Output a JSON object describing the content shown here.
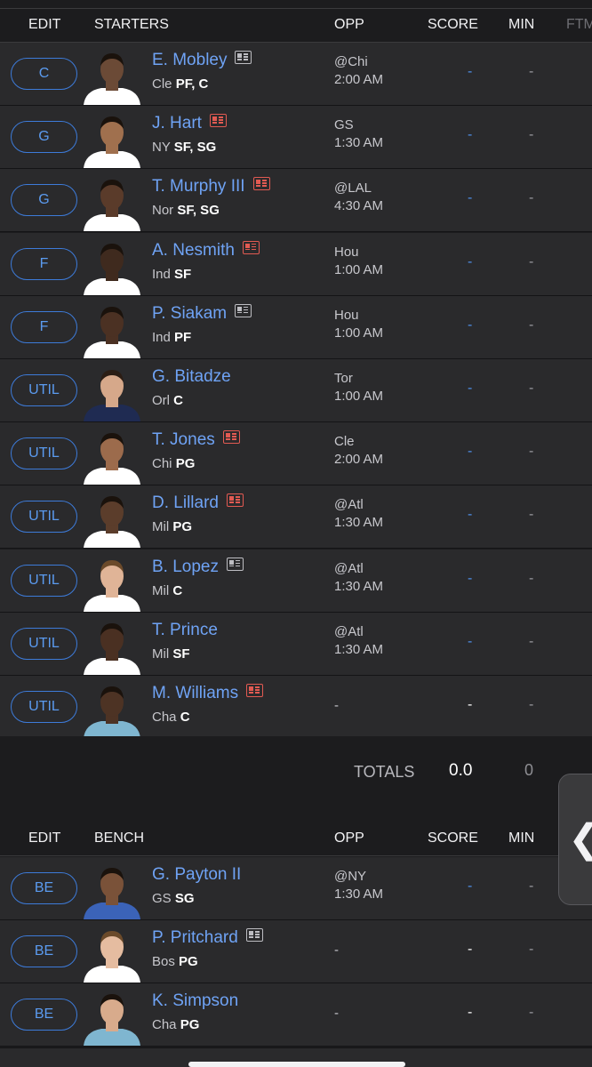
{
  "starters_header": {
    "edit": "EDIT",
    "title": "STARTERS",
    "opp": "OPP",
    "score": "SCORE",
    "min": "MIN",
    "ftm": "FTM"
  },
  "starters": [
    {
      "slot": "C",
      "name": "E. Mobley",
      "team": "Cle",
      "pos": "PF, C",
      "opp": "@Chi",
      "time": "2:00 AM",
      "score": "-",
      "min": "-",
      "news": "normal"
    },
    {
      "slot": "G",
      "name": "J. Hart",
      "team": "NY",
      "pos": "SF, SG",
      "opp": "GS",
      "time": "1:30 AM",
      "score": "-",
      "min": "-",
      "news": "alert"
    },
    {
      "slot": "G",
      "name": "T. Murphy III",
      "team": "Nor",
      "pos": "SF, SG",
      "opp": "@LAL",
      "time": "4:30 AM",
      "score": "-",
      "min": "-",
      "news": "alert"
    },
    {
      "slot": "F",
      "name": "A. Nesmith",
      "team": "Ind",
      "pos": "SF",
      "opp": "Hou",
      "time": "1:00 AM",
      "score": "-",
      "min": "-",
      "news": "alert"
    },
    {
      "slot": "F",
      "name": "P. Siakam",
      "team": "Ind",
      "pos": "PF",
      "opp": "Hou",
      "time": "1:00 AM",
      "score": "-",
      "min": "-",
      "news": "normal"
    },
    {
      "slot": "UTIL",
      "name": "G. Bitadze",
      "team": "Orl",
      "pos": "C",
      "opp": "Tor",
      "time": "1:00 AM",
      "score": "-",
      "min": "-",
      "news": ""
    },
    {
      "slot": "UTIL",
      "name": "T. Jones",
      "team": "Chi",
      "pos": "PG",
      "opp": "Cle",
      "time": "2:00 AM",
      "score": "-",
      "min": "-",
      "news": "alert"
    },
    {
      "slot": "UTIL",
      "name": "D. Lillard",
      "team": "Mil",
      "pos": "PG",
      "opp": "@Atl",
      "time": "1:30 AM",
      "score": "-",
      "min": "-",
      "news": "alert"
    },
    {
      "slot": "UTIL",
      "name": "B. Lopez",
      "team": "Mil",
      "pos": "C",
      "opp": "@Atl",
      "time": "1:30 AM",
      "score": "-",
      "min": "-",
      "news": "normal"
    },
    {
      "slot": "UTIL",
      "name": "T. Prince",
      "team": "Mil",
      "pos": "SF",
      "opp": "@Atl",
      "time": "1:30 AM",
      "score": "-",
      "min": "-",
      "news": ""
    },
    {
      "slot": "UTIL",
      "name": "M. Williams",
      "team": "Cha",
      "pos": "C",
      "opp": "-",
      "time": "",
      "score": "-",
      "min": "-",
      "news": "alert"
    }
  ],
  "totals": {
    "label": "TOTALS",
    "score": "0.0",
    "min": "0"
  },
  "bench_header": {
    "edit": "EDIT",
    "title": "BENCH",
    "opp": "OPP",
    "score": "SCORE",
    "min": "MIN"
  },
  "bench": [
    {
      "slot": "BE",
      "name": "G. Payton II",
      "team": "GS",
      "pos": "SG",
      "opp": "@NY",
      "time": "1:30 AM",
      "score": "-",
      "min": "-",
      "news": ""
    },
    {
      "slot": "BE",
      "name": "P. Pritchard",
      "team": "Bos",
      "pos": "PG",
      "opp": "-",
      "time": "",
      "score": "-",
      "min": "-",
      "news": "normal"
    },
    {
      "slot": "BE",
      "name": "K. Simpson",
      "team": "Cha",
      "pos": "PG",
      "opp": "-",
      "time": "",
      "score": "-",
      "min": "-",
      "news": ""
    }
  ],
  "side_tab": {
    "glyph": "❮"
  },
  "colors": {
    "accent": "#5b9bf0",
    "alert": "#e25a52",
    "row_bg": "#2a2a2c",
    "page_bg": "#1c1c1e"
  },
  "icons": {
    "news": "news-icon",
    "news_alert": "news-alert-icon",
    "collapse": "chevron-left-icon"
  }
}
